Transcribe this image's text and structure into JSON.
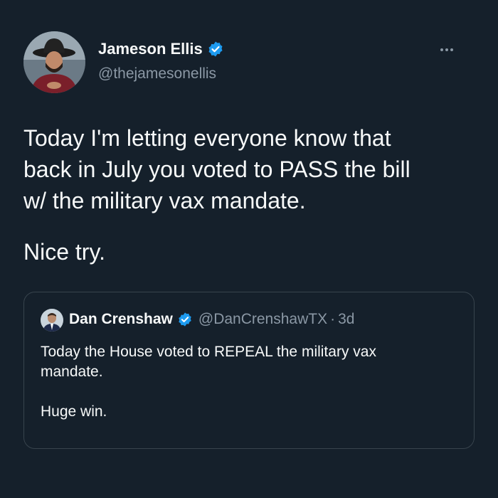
{
  "author": {
    "name": "Jameson Ellis",
    "handle": "@thejamesonellis",
    "verified": true,
    "avatar_icon": "user-avatar"
  },
  "tweet": {
    "lines": [
      "Today I'm letting everyone know that",
      "back in July you voted to PASS the bill",
      "w/ the military vax mandate."
    ],
    "second_paragraph": "Nice try."
  },
  "more_icon": "more-horizontal-icon",
  "quoted_tweet": {
    "author_name": "Dan Crenshaw",
    "author_handle": "@DanCrenshawTX",
    "separator": "·",
    "time": "3d",
    "verified": true,
    "lines": [
      "Today the House voted to REPEAL the military vax",
      "mandate."
    ],
    "closing": "Huge win."
  },
  "colors": {
    "background": "#15202b",
    "text": "#f7f9f9",
    "secondary_text": "#8b98a5",
    "verified_badge": "#1d9bf0",
    "border": "#38444d"
  }
}
